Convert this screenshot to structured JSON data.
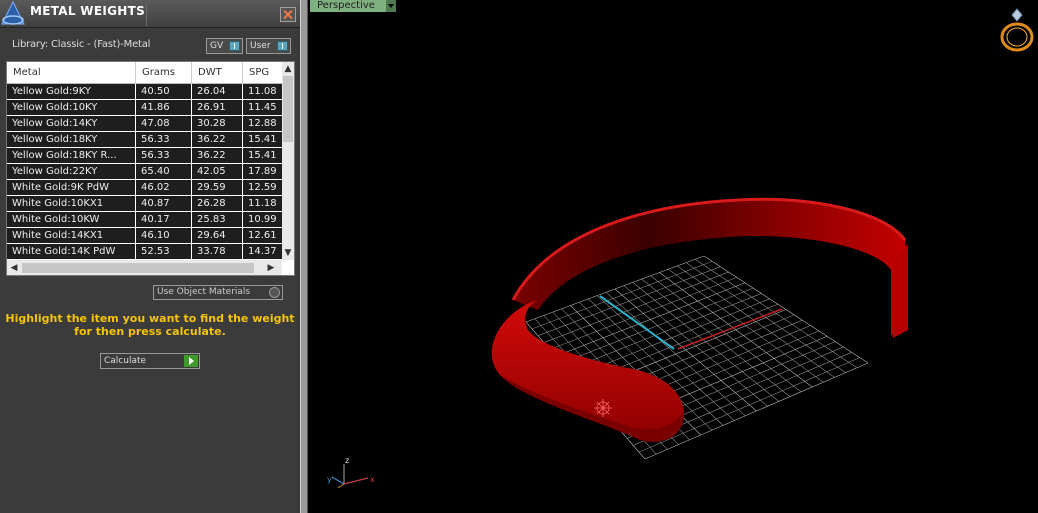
{
  "panel": {
    "title": "METAL WEIGHTS",
    "library_label": "Library: Classic - (Fast)-Metal",
    "option_gv": "GV",
    "option_user": "User",
    "columns": [
      "Metal",
      "Grams",
      "DWT",
      "SPG"
    ],
    "rows": [
      {
        "metal": "Yellow Gold:9KY",
        "grams": "40.50",
        "dwt": "26.04",
        "spg": "11.08"
      },
      {
        "metal": "Yellow Gold:10KY",
        "grams": "41.86",
        "dwt": "26.91",
        "spg": "11.45"
      },
      {
        "metal": "Yellow Gold:14KY",
        "grams": "47.08",
        "dwt": "30.28",
        "spg": "12.88"
      },
      {
        "metal": "Yellow Gold:18KY",
        "grams": "56.33",
        "dwt": "36.22",
        "spg": "15.41"
      },
      {
        "metal": "Yellow Gold:18KY R...",
        "grams": "56.33",
        "dwt": "36.22",
        "spg": "15.41"
      },
      {
        "metal": "Yellow Gold:22KY",
        "grams": "65.40",
        "dwt": "42.05",
        "spg": "17.89"
      },
      {
        "metal": "White Gold:9K PdW",
        "grams": "46.02",
        "dwt": "29.59",
        "spg": "12.59"
      },
      {
        "metal": "White Gold:10KX1",
        "grams": "40.87",
        "dwt": "26.28",
        "spg": "11.18"
      },
      {
        "metal": "White Gold:10KW",
        "grams": "40.17",
        "dwt": "25.83",
        "spg": "10.99"
      },
      {
        "metal": "White Gold:14KX1",
        "grams": "46.10",
        "dwt": "29.64",
        "spg": "12.61"
      },
      {
        "metal": "White Gold:14K PdW",
        "grams": "52.53",
        "dwt": "33.78",
        "spg": "14.37"
      }
    ],
    "use_object_materials": "Use Object Materials",
    "hint_line1": "Highlight the item you want to find the weight",
    "hint_line2": "for then press calculate.",
    "calculate_label": "Calculate"
  },
  "viewport": {
    "view_label": "Perspective",
    "axis_x": "x",
    "axis_y": "y",
    "axis_z": "z"
  },
  "colors": {
    "ring": "#b00000",
    "hint": "#f5c400",
    "panel_bg": "#3b3b3b",
    "grid": "#9a9a9a"
  },
  "icons": [
    "app-logo-icon",
    "close-icon",
    "ring-icon",
    "axes-gizmo-icon",
    "scroll-up-icon",
    "scroll-down-icon",
    "scroll-left-icon",
    "scroll-right-icon",
    "calculate-go-icon"
  ]
}
